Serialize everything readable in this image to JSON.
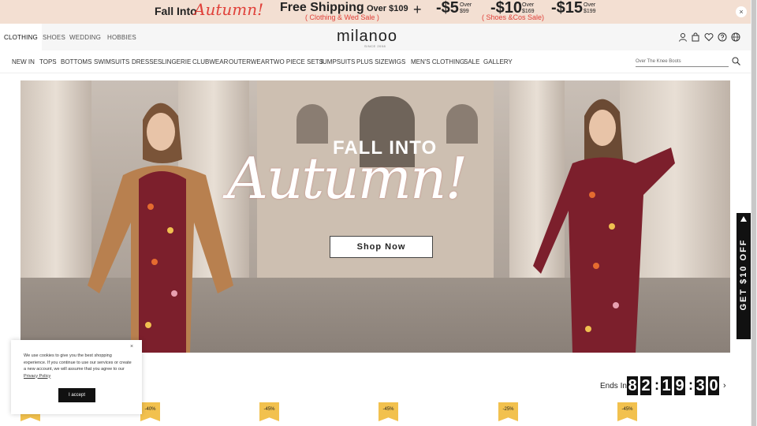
{
  "promo": {
    "fall_into": "Fall Into",
    "autumn": "Autumn!",
    "free_shipping": "Free Shipping",
    "over_109": "Over $109",
    "shipping_sub": "( Clothing & Wed Sale )",
    "plus": "+",
    "offers": [
      {
        "amount": "-$5",
        "over": "Over",
        "threshold": "$99"
      },
      {
        "amount": "-$10",
        "over": "Over",
        "threshold": "$169"
      },
      {
        "amount": "-$15",
        "over": "Over",
        "threshold": "$199"
      }
    ],
    "offers_sub": "( Shoes &Cos Sale)",
    "close": "×"
  },
  "header": {
    "categories": [
      "CLOTHING",
      "SHOES",
      "WEDDING",
      "HOBBIES"
    ],
    "logo": "milanoo",
    "since": "SINCE 2008",
    "icons": [
      "user-icon",
      "bag-icon",
      "heart-icon",
      "help-icon",
      "globe-icon"
    ]
  },
  "nav": {
    "items": [
      "NEW IN",
      "TOPS",
      "BOTTOMS",
      "SWIMSUITS",
      "DRESSES",
      "LINGERIE",
      "CLUBWEAR",
      "OUTERWEAR",
      "TWO PIECE SETS",
      "JUMPSUITS",
      "PLUS SIZE",
      "WIGS",
      "MEN'S CLOTHING",
      "SALE",
      "GALLERY"
    ],
    "search_placeholder": "Over The Knee Boots"
  },
  "hero": {
    "fall_into": "FALL INTO",
    "autumn": "Autumn!",
    "shop_now": "Shop Now"
  },
  "sidetab": {
    "label": "GET $10 OFF"
  },
  "cookie": {
    "text": "We use cookies to give you the best shopping experience. If you continue to use our services or create a new account, we will assume that you agree to our",
    "policy": "Privacy Policy",
    "accept": "I accept",
    "close": "×"
  },
  "countdown": {
    "label": "Ends In",
    "digits": [
      "8",
      "2",
      "1",
      "9",
      "3",
      "0"
    ],
    "next": "›"
  },
  "tags": [
    "",
    "-40%",
    "-45%",
    "-45%",
    "-25%",
    "-45%"
  ],
  "colors": {
    "accent": "#e0413a",
    "promo_bg": "#f3dfd2",
    "tag": "#f2c14e"
  }
}
